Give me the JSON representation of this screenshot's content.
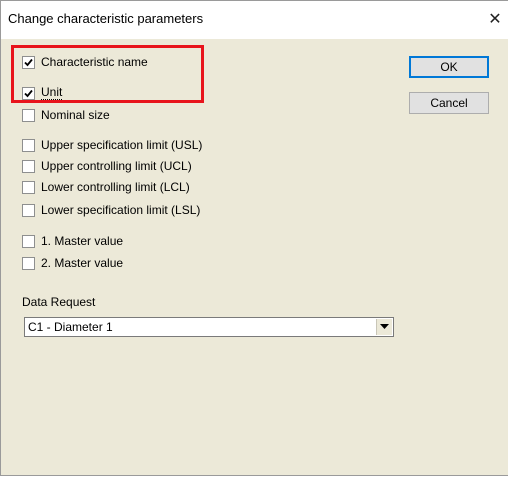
{
  "window": {
    "title": "Change characteristic parameters",
    "close_glyph": "✕"
  },
  "checkboxes": [
    {
      "label": "Characteristic name",
      "checked": true
    },
    {
      "label": "Unit",
      "checked": true
    },
    {
      "label": "Nominal size",
      "checked": false
    },
    {
      "label": "Upper specification limit (USL)",
      "checked": false
    },
    {
      "label": "Upper controlling limit (UCL)",
      "checked": false
    },
    {
      "label": "Lower controlling limit (LCL)",
      "checked": false
    },
    {
      "label": "Lower specification limit (LSL)",
      "checked": false
    },
    {
      "label": "1. Master value",
      "checked": false
    },
    {
      "label": "2. Master value",
      "checked": false
    }
  ],
  "buttons": {
    "ok_label": "OK",
    "cancel_label": "Cancel"
  },
  "data_request": {
    "label": "Data Request",
    "selected": "C1 - Diameter 1"
  },
  "colors": {
    "highlight": "#e8141c",
    "dialog_bg": "#ece9d8"
  },
  "icons": {
    "check": "checkmark-icon",
    "dropdown": "chevron-down-icon",
    "close": "close-icon"
  }
}
